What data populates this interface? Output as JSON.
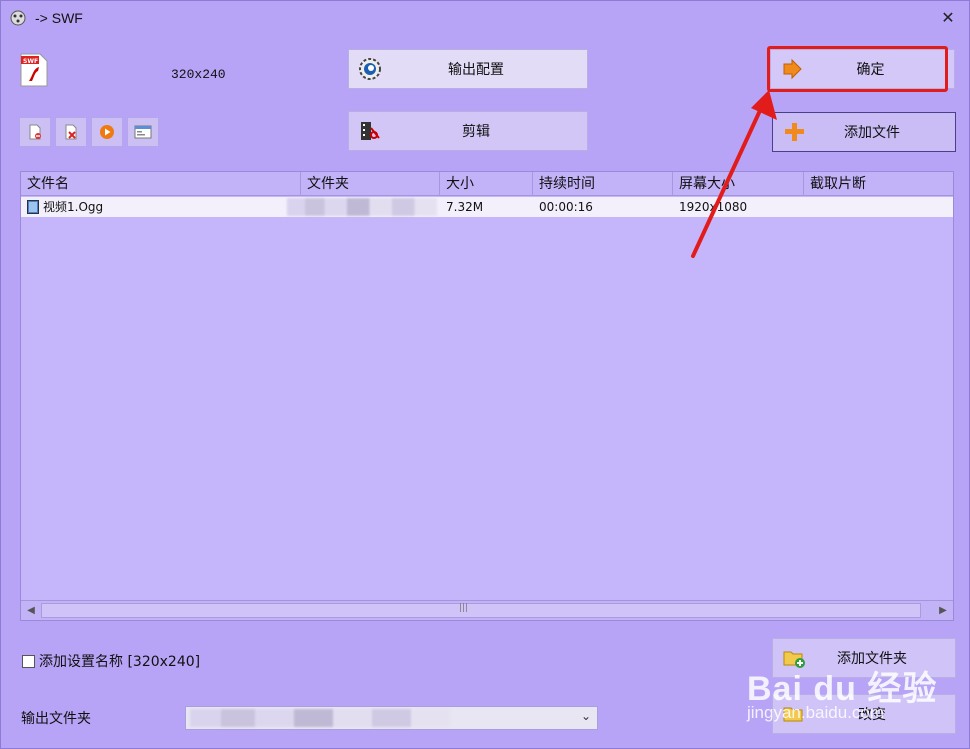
{
  "window": {
    "title": "-> SWF"
  },
  "top": {
    "resolution": "320x240",
    "config_button": "输出配置",
    "edit_button": "剪辑",
    "ok_button": "确定",
    "add_file_button": "添加文件"
  },
  "list": {
    "columns": [
      "文件名",
      "文件夹",
      "大小",
      "持续时间",
      "屏幕大小",
      "截取片断"
    ],
    "rows": [
      {
        "name": "视频1.Ogg",
        "folder": "",
        "size": "7.32M",
        "duration": "00:00:16",
        "screen": "1920x1080",
        "clip": ""
      }
    ]
  },
  "bottom": {
    "add_setting_name": "添加设置名称 [320x240]",
    "add_folder_button": "添加文件夹",
    "change_button": "改变",
    "output_folder_label": "输出文件夹"
  },
  "watermark": {
    "brand": "Bai du 经验",
    "url": "jingyan.baidu.com"
  },
  "colors": {
    "background": "#b7a4f6",
    "highlight": "#e21b1b"
  }
}
